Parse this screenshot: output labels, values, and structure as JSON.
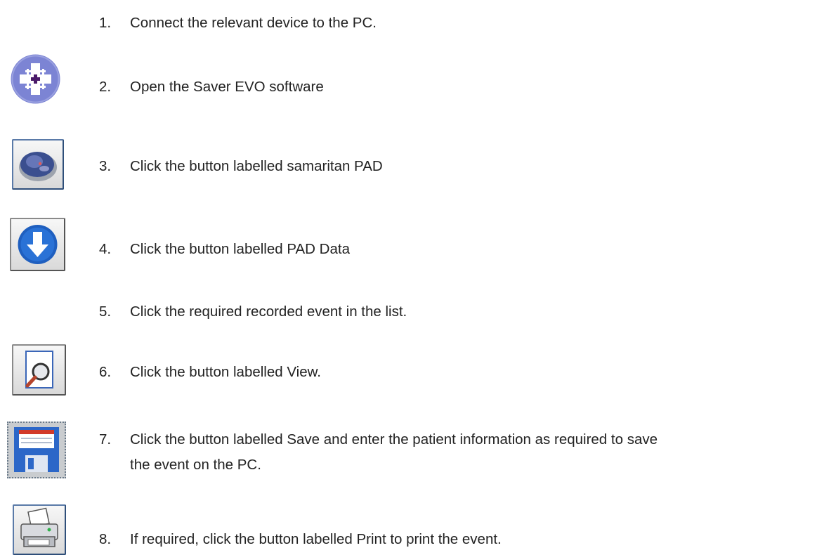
{
  "steps": [
    {
      "num": "1.",
      "text": "Connect the relevant device to the PC."
    },
    {
      "num": "2.",
      "text": "Open the Saver EVO software"
    },
    {
      "num": "3.",
      "text": "Click the button labelled samaritan PAD"
    },
    {
      "num": "4.",
      "text": "Click the button labelled PAD Data"
    },
    {
      "num": "5.",
      "text": "Click the required recorded event in the list."
    },
    {
      "num": "6.",
      "text": "Click the button labelled View."
    },
    {
      "num": "7.",
      "text": "Click the button labelled Save and enter the patient information as required to save",
      "text2": "the event on the PC."
    },
    {
      "num": "8.",
      "text": "If required, click the button labelled Print to print the event."
    }
  ],
  "icons": {
    "step2": "saver-evo-app-icon",
    "step3": "samaritan-pad-icon",
    "step4": "download-arrow-icon",
    "step6": "view-magnifier-icon",
    "step7": "save-floppy-icon",
    "step8": "printer-icon"
  },
  "colors": {
    "text": "#222222",
    "app_icon": "#7c84d4",
    "download_blue": "#1f5fbf",
    "floppy_blue": "#2c67c8",
    "floppy_red": "#d23a2a"
  }
}
